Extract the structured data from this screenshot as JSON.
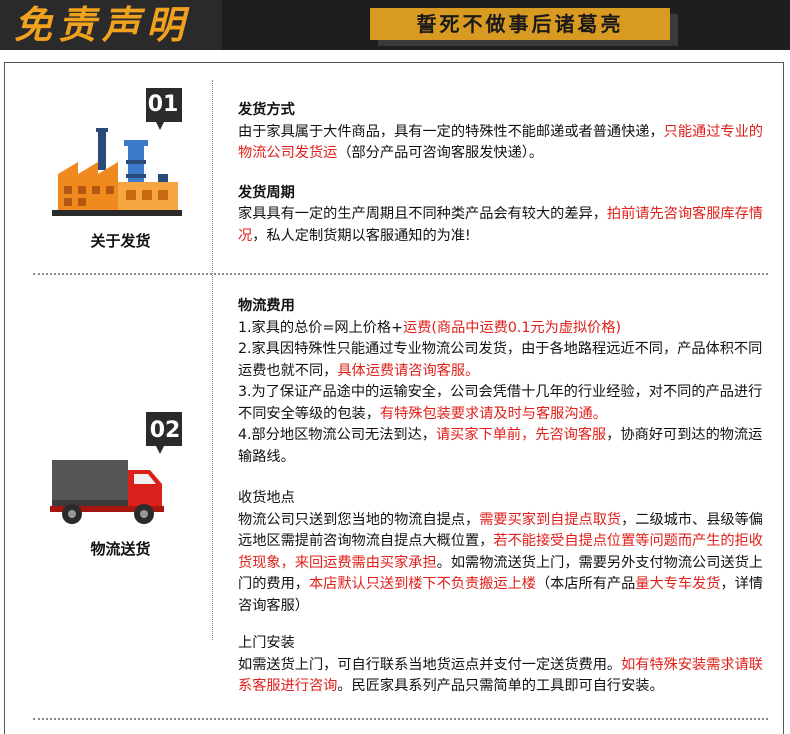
{
  "banner": {
    "title": "免责声明",
    "slogan": "誓死不做事后诸葛亮"
  },
  "section1": {
    "badge": "01",
    "label": "关于发货",
    "shipping_method": {
      "heading": "发货方式",
      "t1": "由于家具属于大件商品，具有一定的特殊性不能邮递或者普通快递，",
      "r1": "只能通过专业的物流公司发货运",
      "t2": "（部分产品可咨询客服发快递）。"
    },
    "shipping_period": {
      "heading": "发货周期",
      "t1": "家具具有一定的生产周期且不同种类产品会有较大的差异，",
      "r1": "拍前请先咨询客服库存情况",
      "t2": "，私人定制货期以客服通知的为准!"
    }
  },
  "section2": {
    "badge": "02",
    "label": "物流送货",
    "fees": {
      "heading": "物流费用",
      "l1_t": "1.家具的总价=网上价格+",
      "l1_r": "运费(商品中运费0.1元为虚拟价格)",
      "l2_t": "2.家具因特殊性只能通过专业物流公司发货，由于各地路程远近不同，产品体积不同运费也就不同，",
      "l2_r": "具体运费请咨询客服。",
      "l3_t": "3.为了保证产品途中的运输安全，公司会凭借十几年的行业经验，对不同的产品进行不同安全等级的包装，",
      "l3_r": "有特殊包装要求请及时与客服沟通。",
      "l4_t": "4.部分地区物流公司无法到达，",
      "l4_r": "请买家下单前，先咨询客服",
      "l4_t2": "，协商好可到达的物流运输路线。"
    },
    "pickup": {
      "heading": "收货地点",
      "t1": "物流公司只送到您当地的物流自提点，",
      "r1": "需要买家到自提点取货",
      "t2": "，二级城市、县级等偏远地区需提前咨询物流自提点大概位置，",
      "r2": "若不能接受自提点位置等问题而产生的拒收货现象，来回运费需由买家承担",
      "t3": "。如需物流送货上门，需要另外支付物流公司送货上门的费用，",
      "r3": "本店默认只送到楼下不负责搬运上楼",
      "t4": "（本店所有产品",
      "r4": "量大专车发货",
      "t5": "，详情咨询客服）"
    },
    "delivery": {
      "heading": "上门安装",
      "t1": "如需送货上门，可自行联系当地货运点并支付一定送货费用。",
      "r1": "如有特殊安装需求请联系客服进行咨询",
      "t2": "。民匠家具系列产品只需简单的工具即可自行安装。"
    }
  },
  "colors": {
    "accent_red": "#e0201a",
    "banner_gold": "#f0a21e",
    "banner_dark": "#1e1e1e"
  }
}
